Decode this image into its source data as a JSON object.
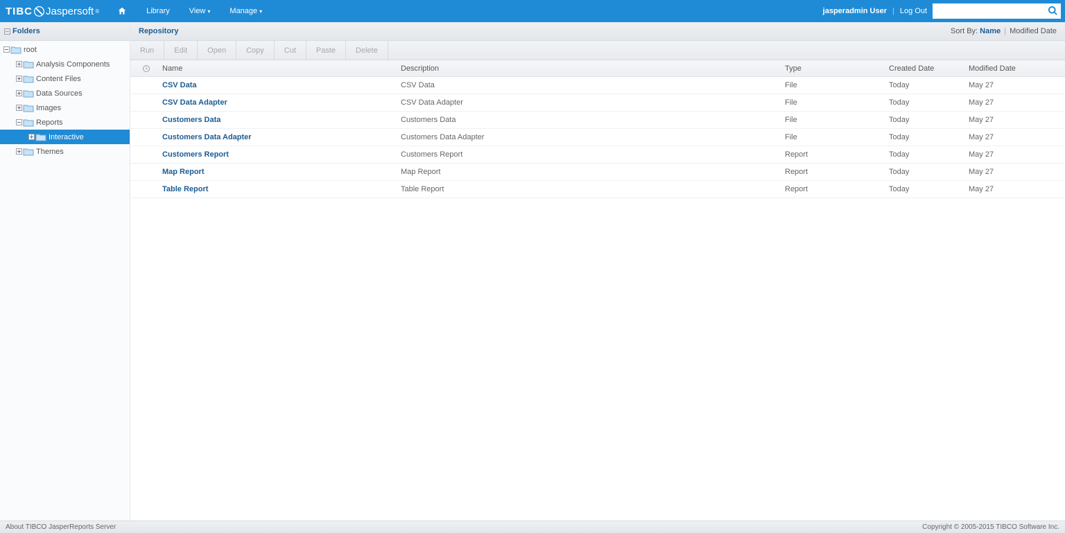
{
  "brand": {
    "part1": "TIBC",
    "part2": "Jaspersoft"
  },
  "nav": {
    "library": "Library",
    "view": "View",
    "manage": "Manage"
  },
  "user": {
    "name": "jasperadmin User",
    "logout": "Log Out",
    "search_placeholder": ""
  },
  "sidebar": {
    "title": "Folders",
    "root": "root",
    "items": [
      "Analysis Components",
      "Content Files",
      "Data Sources",
      "Images",
      "Reports",
      "Interactive",
      "Themes"
    ]
  },
  "main": {
    "title": "Repository",
    "sortby_label": "Sort By:",
    "sort_name": "Name",
    "sort_modified": "Modified Date",
    "toolbar": {
      "run": "Run",
      "edit": "Edit",
      "open": "Open",
      "copy": "Copy",
      "cut": "Cut",
      "paste": "Paste",
      "delete": "Delete"
    },
    "columns": {
      "name": "Name",
      "description": "Description",
      "type": "Type",
      "created": "Created Date",
      "modified": "Modified Date"
    },
    "rows": [
      {
        "name": "CSV Data",
        "description": "CSV Data",
        "type": "File",
        "created": "Today",
        "modified": "May 27"
      },
      {
        "name": "CSV Data Adapter",
        "description": "CSV Data Adapter",
        "type": "File",
        "created": "Today",
        "modified": "May 27"
      },
      {
        "name": "Customers Data",
        "description": "Customers Data",
        "type": "File",
        "created": "Today",
        "modified": "May 27"
      },
      {
        "name": "Customers Data Adapter",
        "description": "Customers Data Adapter",
        "type": "File",
        "created": "Today",
        "modified": "May 27"
      },
      {
        "name": "Customers Report",
        "description": "Customers Report",
        "type": "Report",
        "created": "Today",
        "modified": "May 27"
      },
      {
        "name": "Map Report",
        "description": "Map Report",
        "type": "Report",
        "created": "Today",
        "modified": "May 27"
      },
      {
        "name": "Table Report",
        "description": "Table Report",
        "type": "Report",
        "created": "Today",
        "modified": "May 27"
      }
    ]
  },
  "footer": {
    "about": "About TIBCO JasperReports Server",
    "copyright": "Copyright © 2005-2015 TIBCO Software Inc."
  }
}
